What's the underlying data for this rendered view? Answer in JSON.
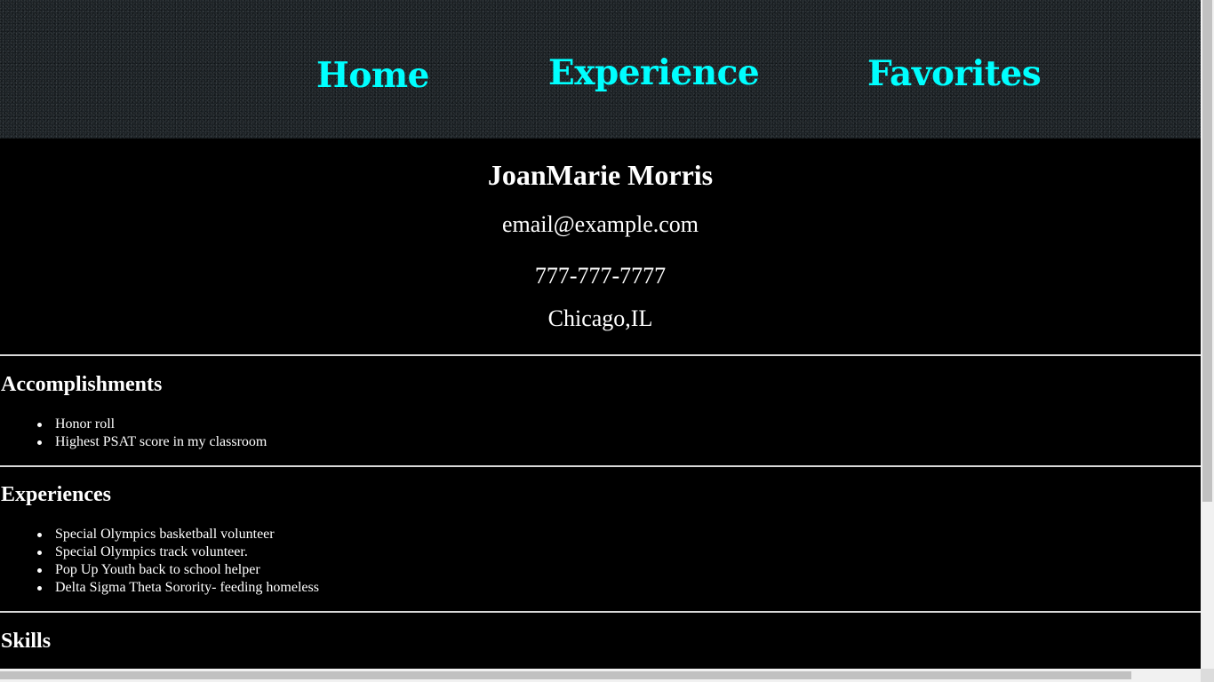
{
  "nav": {
    "links": [
      "Home",
      "Experience",
      "Favorites"
    ]
  },
  "contact": {
    "name": "JoanMarie Morris",
    "email": "email@example.com",
    "phone": "777-777-7777",
    "location": "Chicago,IL"
  },
  "sections": {
    "accomplishments": {
      "title": "Accomplishments",
      "items": [
        "Honor roll",
        "Highest PSAT score in my classroom"
      ]
    },
    "experiences": {
      "title": "Experiences",
      "items": [
        "Special Olympics basketball volunteer",
        "Special Olympics track volunteer.",
        "Pop Up Youth back to school helper",
        "Delta Sigma Theta Sorority- feeding homeless"
      ]
    },
    "skills": {
      "title": "Skills"
    }
  },
  "colors": {
    "nav_link": "#00ffff",
    "background": "#000000",
    "text": "#ffffff",
    "rule": "#d9d9d9"
  }
}
